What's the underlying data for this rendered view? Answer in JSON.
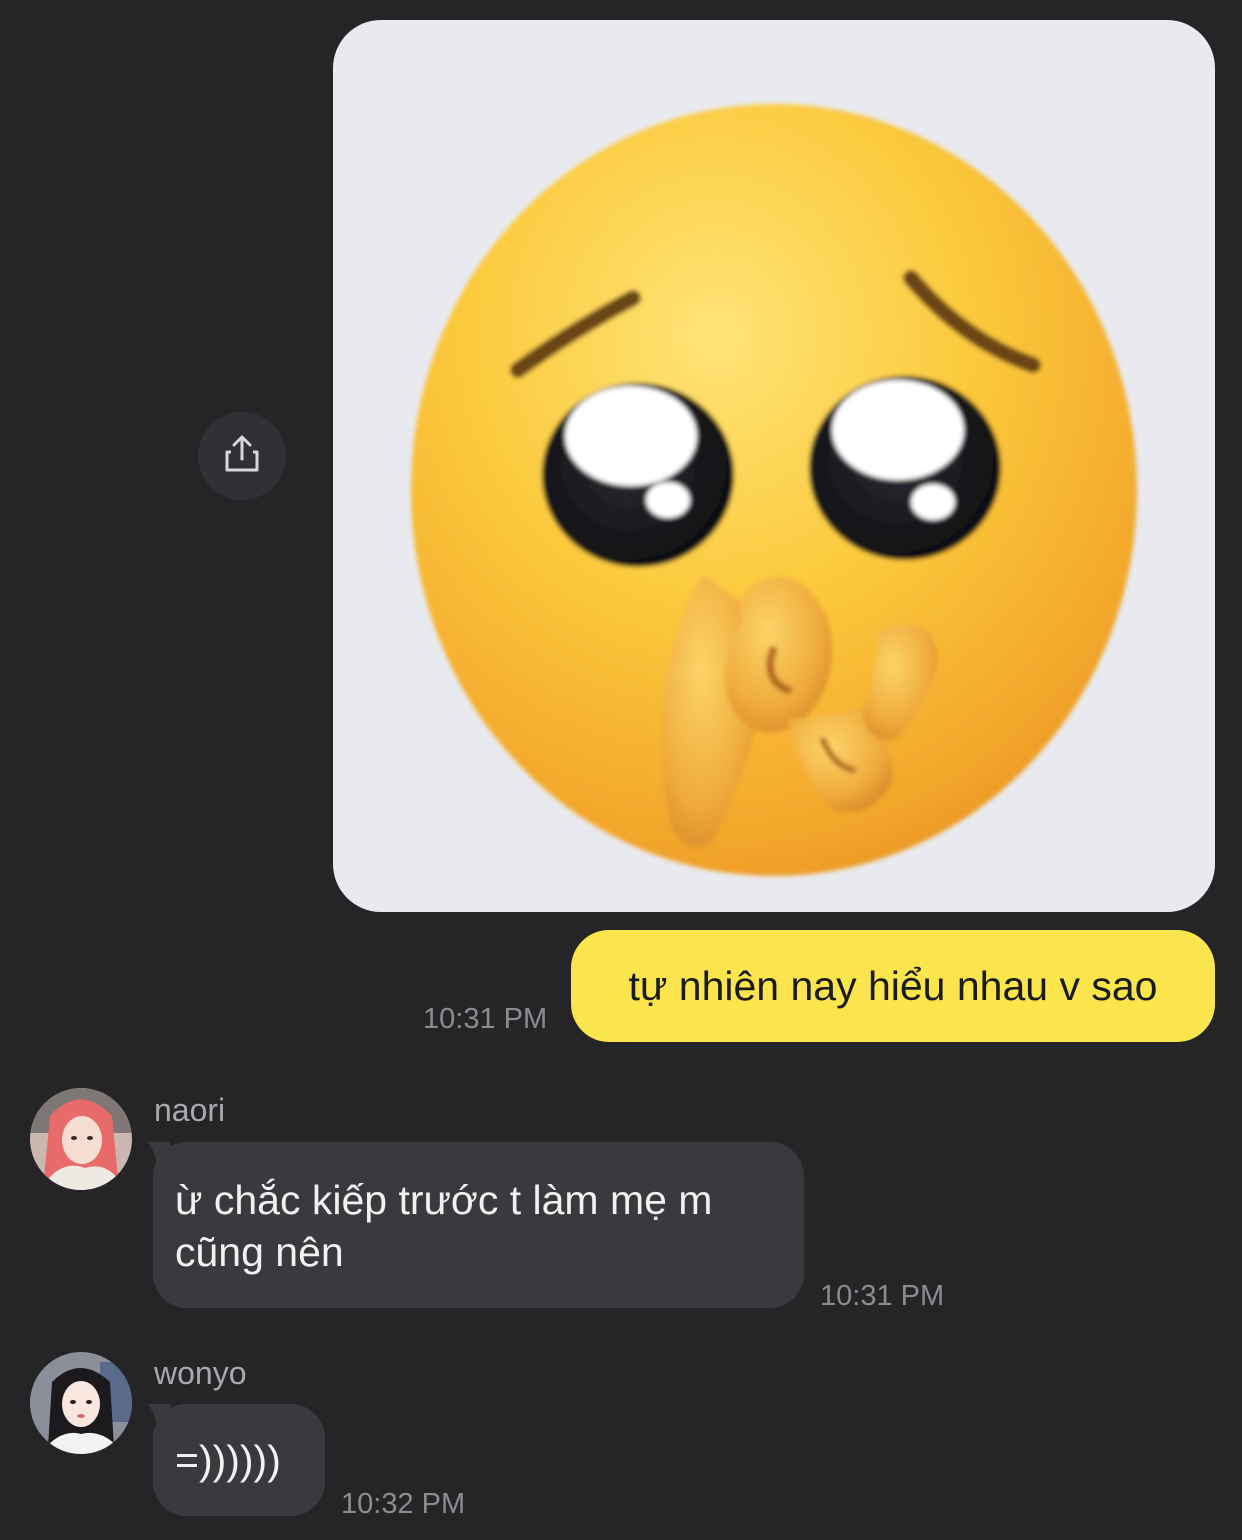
{
  "messages": {
    "outgoing_image": {
      "alt": "face holding back tears emoji image"
    },
    "outgoing_text": {
      "text": "tự nhiên nay hiểu nhau v sao",
      "time": "10:31 PM"
    },
    "incoming_1": {
      "sender": "naori",
      "text_line1": "ừ chắc kiếp trước t làm mẹ m",
      "text_line2": "cũng nên",
      "time": "10:31 PM"
    },
    "incoming_2": {
      "sender": "wonyo",
      "text": "=))))))",
      "time": "10:32 PM"
    }
  },
  "icons": {
    "share": "share-icon"
  },
  "colors": {
    "background": "#252528",
    "outgoing_bubble": "#fbe54d",
    "incoming_bubble": "#3a3a3e",
    "timestamp": "#8c8c90"
  }
}
